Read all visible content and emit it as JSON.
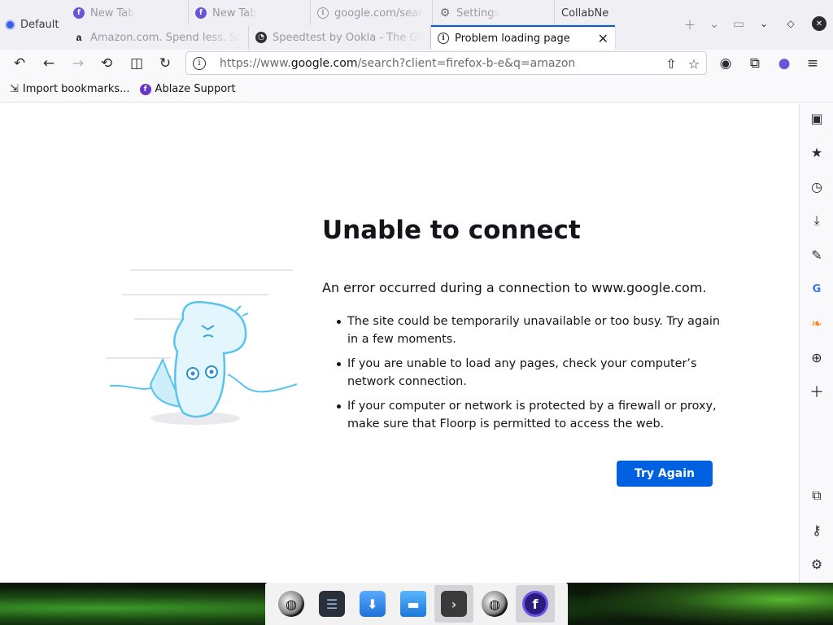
{
  "workspace": {
    "label": "Default"
  },
  "tabs_row1": [
    {
      "label": "New Tab",
      "icon": "floorp-icon"
    },
    {
      "label": "New Tab",
      "icon": "floorp-icon"
    },
    {
      "label": "google.com/search",
      "icon": "info-icon"
    },
    {
      "label": "Settings",
      "icon": "gear-icon"
    },
    {
      "label": "CollabNet",
      "icon": "none"
    }
  ],
  "tabs_row2": [
    {
      "label": "Amazon.com. Spend less. Smile more.",
      "icon": "amazon-icon"
    },
    {
      "label": "Speedtest by Ookla - The Global Broadband Speed Test",
      "icon": "speedtest-icon"
    },
    {
      "label": "Problem loading page",
      "icon": "info-icon",
      "selected": true
    }
  ],
  "urlbar": {
    "prefix": "https://www.",
    "host": "google.com",
    "suffix": "/search?client=firefox-b-e&q=amazon"
  },
  "bookmarks": [
    {
      "label": "Import bookmarks...",
      "icon": "import-icon"
    },
    {
      "label": "Ablaze Support",
      "icon": "floorp-icon"
    }
  ],
  "error": {
    "title": "Unable to connect",
    "intro": "An error occurred during a connection to www.google.com.",
    "items": [
      "The site could be temporarily unavailable or too busy. Try again in a few moments.",
      "If you are unable to load any pages, check your computer’s network connection.",
      "If your computer or network is protected by a firewall or proxy, make sure that Floorp is permitted to access the web."
    ],
    "button": "Try Again"
  },
  "sidebar": [
    "toolbox-icon",
    "bookmark-star-icon",
    "history-clock-icon",
    "download-icon",
    "pencil-icon",
    "translate-icon",
    "leaf-icon",
    "globe-icon",
    "add-icon",
    "extensions-icon",
    "key-icon",
    "settings-gear-icon"
  ],
  "taskbar": [
    "globe-app-icon",
    "settings-app-icon",
    "store-app-icon",
    "folder-app-icon",
    "terminal-app-icon",
    "globe-app-icon",
    "floorp-app-icon"
  ],
  "colors": {
    "accent": "#0061e0",
    "floorp": "#6a55d6"
  }
}
